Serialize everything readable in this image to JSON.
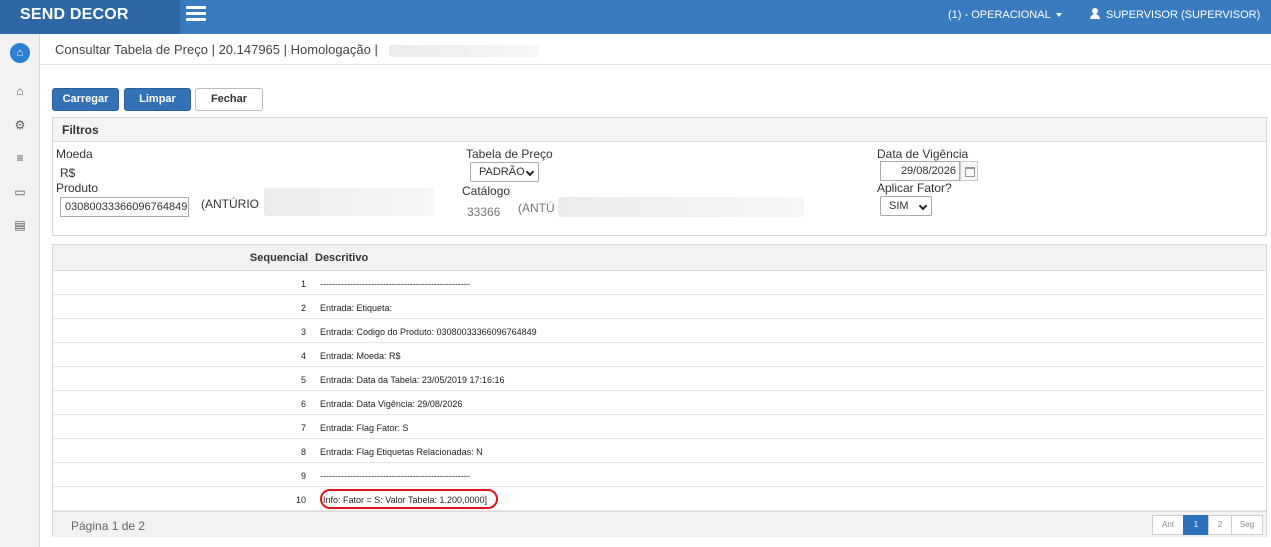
{
  "header": {
    "brand": "SEND DECOR",
    "role_menu": "(1) - OPERACIONAL",
    "user_menu": "SUPERVISOR (SUPERVISOR)"
  },
  "breadcrumb": {
    "text": "Consultar Tabela de Preço | 20.147965 | Homologação |"
  },
  "toolbar": {
    "load_label": "Carregar",
    "clear_label": "Limpar",
    "close_label": "Fechar"
  },
  "filters": {
    "title": "Filtros",
    "moeda_label": "Moeda",
    "moeda_value": "R$",
    "produto_label": "Produto",
    "produto_value": "03080033366096764849",
    "produto_desc": "(ANTÚRIO",
    "tabela_label": "Tabela de Preço",
    "tabela_value": "PADRÃO",
    "catalogo_label": "Catálogo",
    "catalogo_code": "33366",
    "catalogo_desc": "(ANTÚ",
    "vigencia_label": "Data de Vigência",
    "vigencia_value": "29/08/2026",
    "fator_label": "Aplicar Fator?",
    "fator_value": "SIM"
  },
  "grid": {
    "columns": [
      "Sequencial",
      "Descritivo"
    ],
    "rows": [
      {
        "seq": "1",
        "desc": "--------------------------------------------------"
      },
      {
        "seq": "2",
        "desc": "Entrada: Etiqueta:"
      },
      {
        "seq": "3",
        "desc": "Entrada: Codigo do Produto: 03080033366096764849"
      },
      {
        "seq": "4",
        "desc": "Entrada: Moeda: R$"
      },
      {
        "seq": "5",
        "desc": "Entrada: Data da Tabela: 23/05/2019 17:16:16"
      },
      {
        "seq": "6",
        "desc": "Entrada: Data Vigência: 29/08/2026"
      },
      {
        "seq": "7",
        "desc": "Entrada: Flag Fator: S"
      },
      {
        "seq": "8",
        "desc": "Entrada: Flag Etiquetas Relacionadas: N"
      },
      {
        "seq": "9",
        "desc": "--------------------------------------------------"
      },
      {
        "seq": "10",
        "desc": "Info: Fator = S: Valor Tabela: 1.200,0000]"
      }
    ],
    "page_info": "Página 1 de 2",
    "pager": {
      "prev": "Ant",
      "pages": [
        "1",
        "2"
      ],
      "next": "Seg",
      "active": "1"
    }
  },
  "icons": [
    "menu-icon",
    "logo-icon",
    "home-icon",
    "gears-icon",
    "sliders-icon",
    "laptop-icon",
    "document-icon",
    "user-icon"
  ],
  "colors": {
    "header": "#3a7bbf",
    "brand_bg": "#2d67a5",
    "primary_button": "#3471b5",
    "highlight": "#e0141e"
  }
}
